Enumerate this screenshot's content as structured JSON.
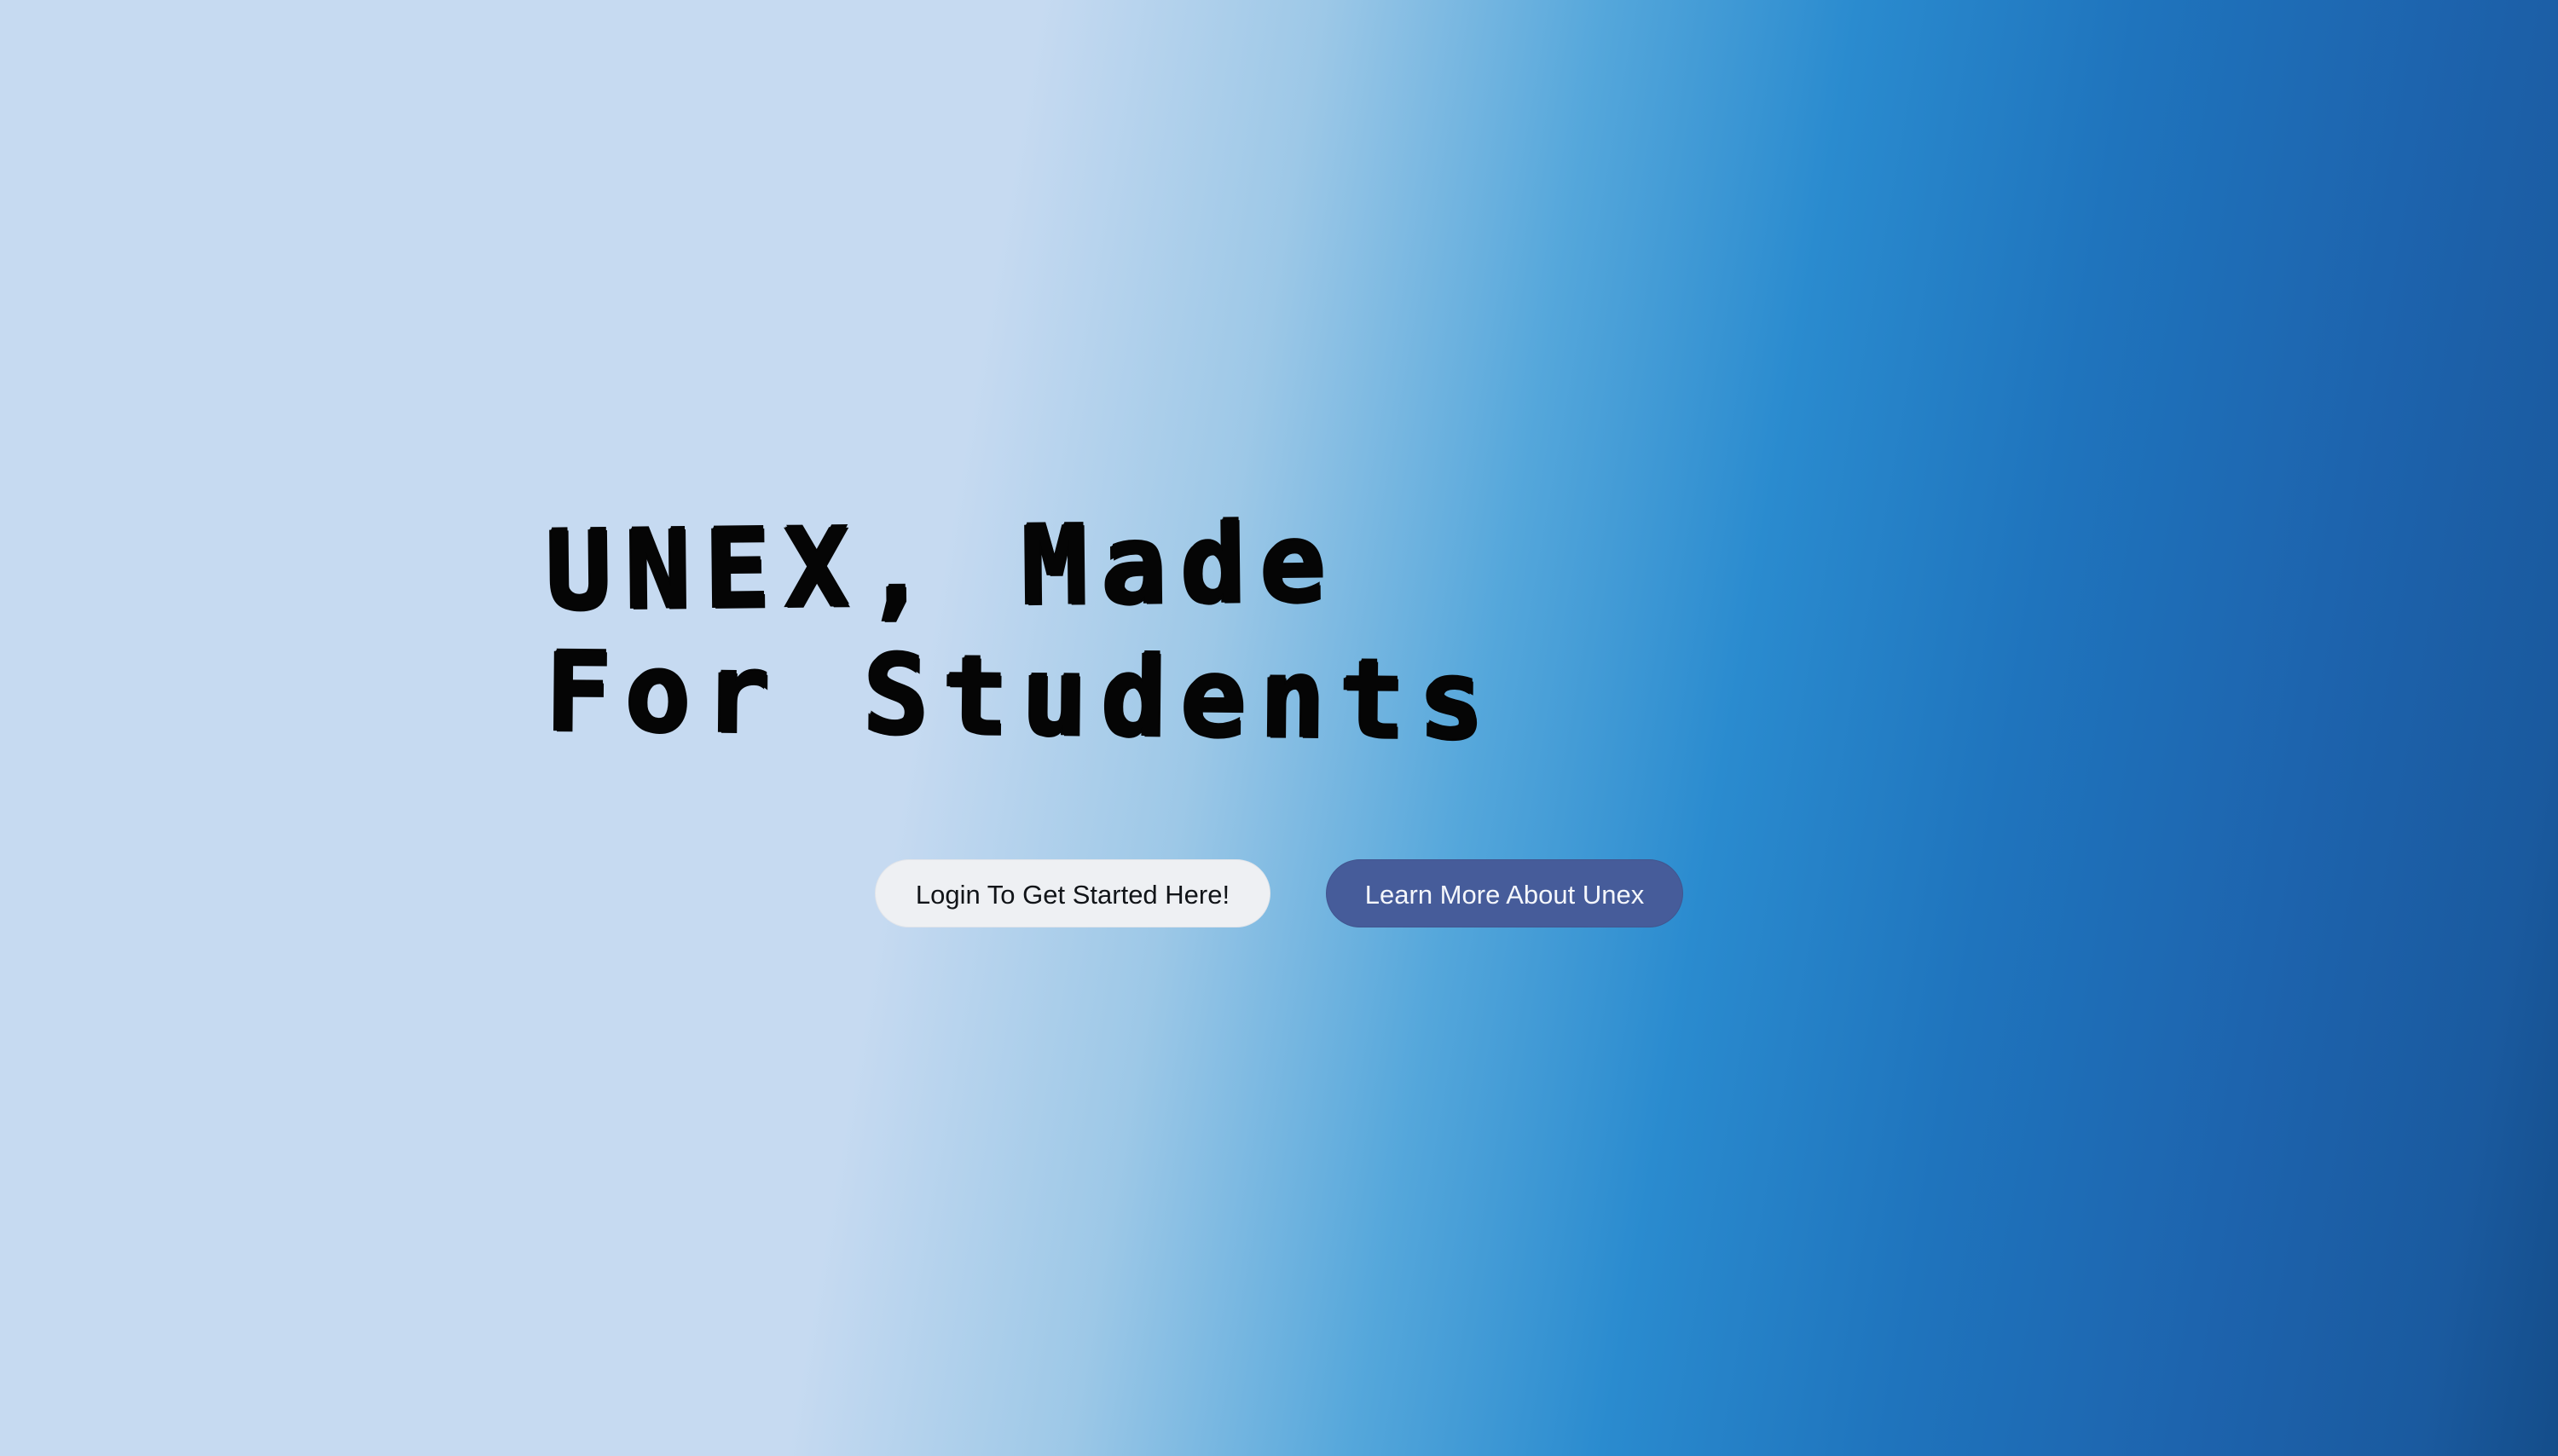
{
  "hero": {
    "headline_line1": "UNEX, Made",
    "headline_line2": "For Students"
  },
  "actions": {
    "login_label": "Login To Get Started Here!",
    "learn_more_label": "Learn More About Unex"
  },
  "colors": {
    "gradient_light": "#c6daf1",
    "gradient_mid": "#2a8bcf",
    "gradient_dark": "#144d8a",
    "login_button_bg": "#eef0f3",
    "learn_button_bg": "#465c9a",
    "headline_text": "#050505"
  }
}
